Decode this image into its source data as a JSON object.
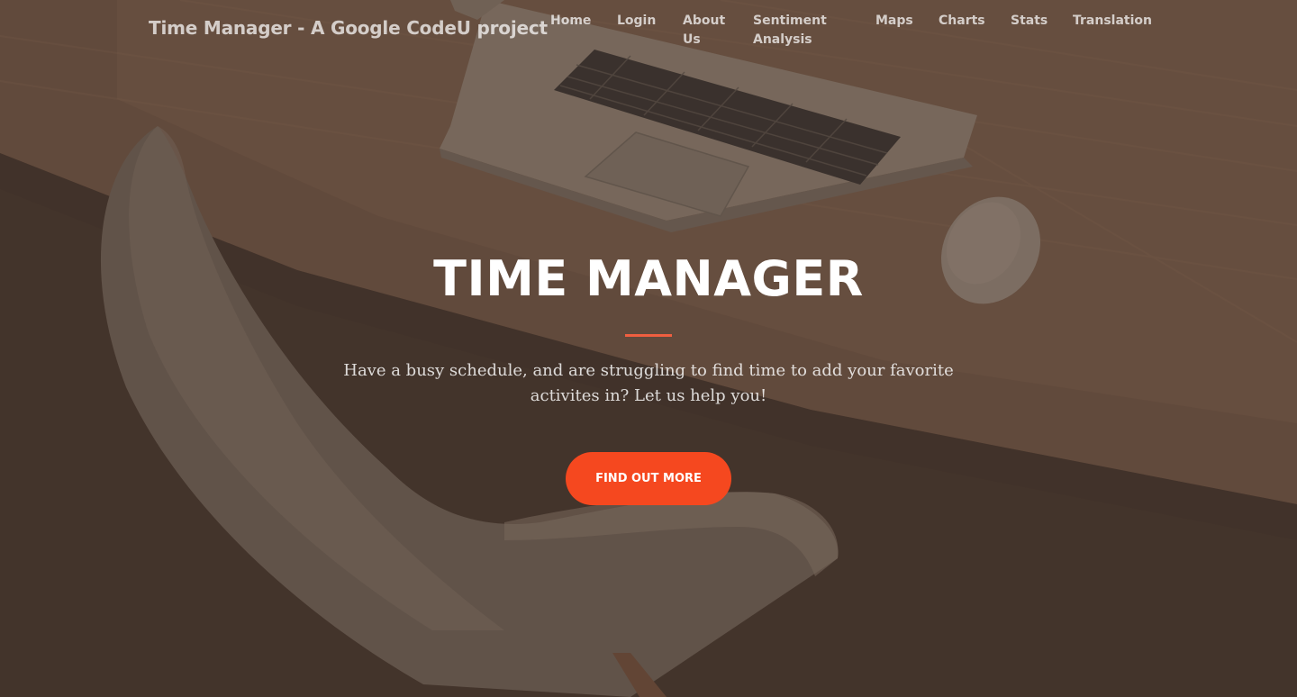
{
  "navbar": {
    "brand": "Time Manager - A Google CodeU project",
    "items": [
      {
        "label": "Home"
      },
      {
        "label": "Login"
      },
      {
        "label": "About Us"
      },
      {
        "label": "Sentiment Analysis"
      },
      {
        "label": "Maps"
      },
      {
        "label": "Charts"
      },
      {
        "label": "Stats"
      },
      {
        "label": "Translation"
      }
    ]
  },
  "hero": {
    "title": "TIME MANAGER",
    "subtitle": "Have a busy schedule, and are struggling to find time to add your favorite activites in? Let us help you!",
    "button_label": "FIND OUT MORE"
  },
  "colors": {
    "accent": "#f05f40",
    "button": "#f5481f",
    "overlay": "#4b3a31"
  }
}
